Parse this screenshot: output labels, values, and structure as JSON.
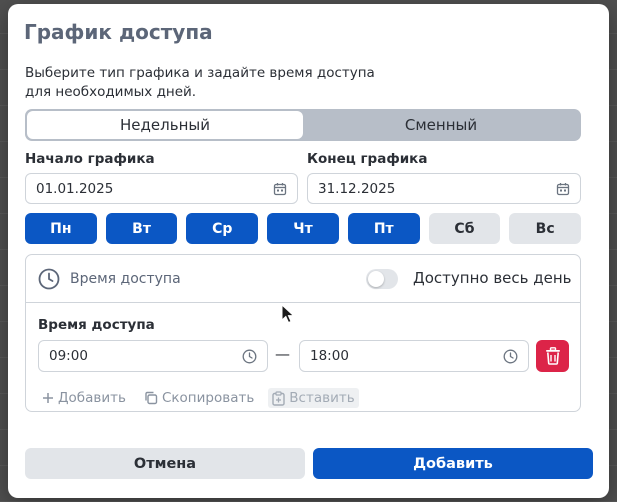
{
  "dialog": {
    "title": "График доступа",
    "subtitle": "Выберите тип графика и задайте время доступа для необходимых дней."
  },
  "schedule_type": {
    "options": [
      "Недельный",
      "Сменный"
    ],
    "selected": "Недельный"
  },
  "start": {
    "label": "Начало графика",
    "value": "01.01.2025"
  },
  "end": {
    "label": "Конец графика",
    "value": "31.12.2025"
  },
  "days": [
    {
      "label": "Пн",
      "active": true
    },
    {
      "label": "Вт",
      "active": true
    },
    {
      "label": "Ср",
      "active": true
    },
    {
      "label": "Чт",
      "active": true
    },
    {
      "label": "Пт",
      "active": true
    },
    {
      "label": "Сб",
      "active": false
    },
    {
      "label": "Вс",
      "active": false
    }
  ],
  "access": {
    "header": "Время доступа",
    "all_day_label": "Доступно весь день",
    "all_day": false,
    "time_label": "Время доступа",
    "from": "09:00",
    "separator": "—",
    "to": "18:00",
    "add_label": "Добавить",
    "copy_label": "Скопировать",
    "paste_label": "Вставить"
  },
  "footer": {
    "cancel_label": "Отмена",
    "submit_label": "Добавить"
  },
  "colors": {
    "primary": "#0b57c4",
    "danger": "#dc2448",
    "neutral": "#e2e5e9",
    "title": "#5c6678"
  }
}
